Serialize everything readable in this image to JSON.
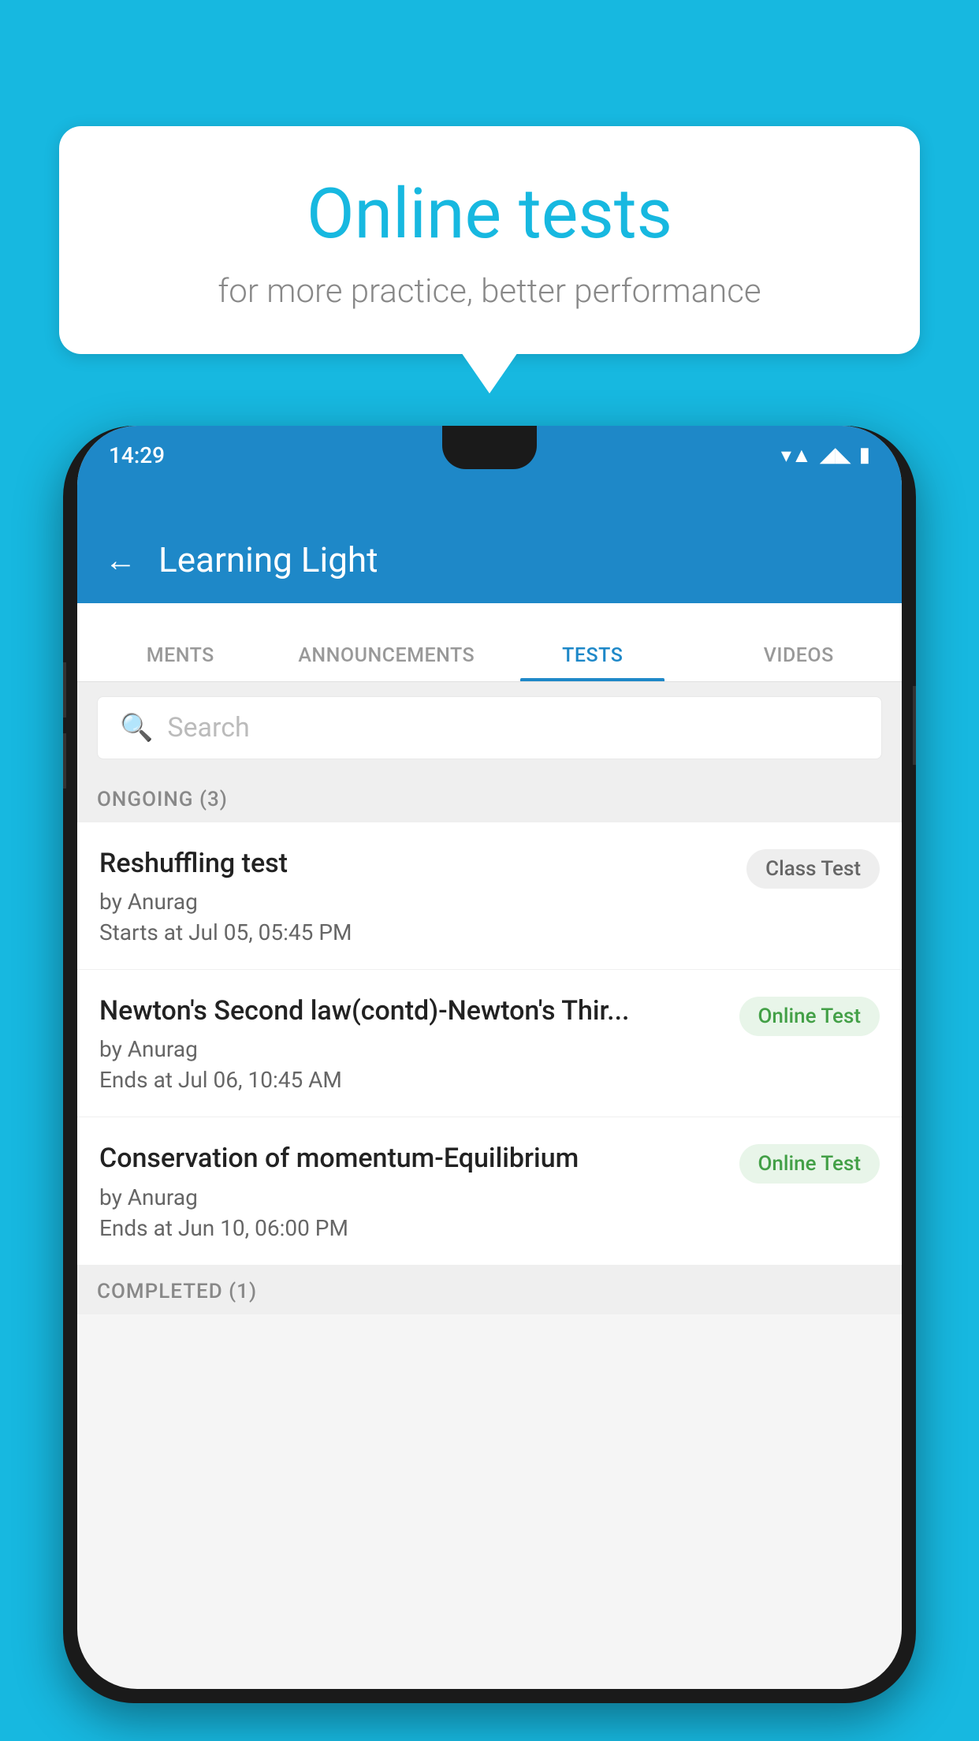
{
  "background": {
    "color": "#17B8E0"
  },
  "speech_bubble": {
    "title": "Online tests",
    "subtitle": "for more practice, better performance"
  },
  "phone": {
    "status_bar": {
      "time": "14:29",
      "icons": [
        "wifi",
        "signal",
        "battery"
      ]
    },
    "app_bar": {
      "title": "Learning Light",
      "back_label": "←"
    },
    "tabs": [
      {
        "label": "MENTS",
        "active": false
      },
      {
        "label": "ANNOUNCEMENTS",
        "active": false
      },
      {
        "label": "TESTS",
        "active": true
      },
      {
        "label": "VIDEOS",
        "active": false
      }
    ],
    "search": {
      "placeholder": "Search"
    },
    "sections": [
      {
        "header": "ONGOING (3)",
        "tests": [
          {
            "name": "Reshuffling test",
            "author": "by Anurag",
            "time": "Starts at  Jul 05, 05:45 PM",
            "tag": "Class Test",
            "tag_type": "class"
          },
          {
            "name": "Newton's Second law(contd)-Newton's Thir...",
            "author": "by Anurag",
            "time": "Ends at  Jul 06, 10:45 AM",
            "tag": "Online Test",
            "tag_type": "online"
          },
          {
            "name": "Conservation of momentum-Equilibrium",
            "author": "by Anurag",
            "time": "Ends at  Jun 10, 06:00 PM",
            "tag": "Online Test",
            "tag_type": "online"
          }
        ]
      },
      {
        "header": "COMPLETED (1)",
        "tests": []
      }
    ]
  }
}
